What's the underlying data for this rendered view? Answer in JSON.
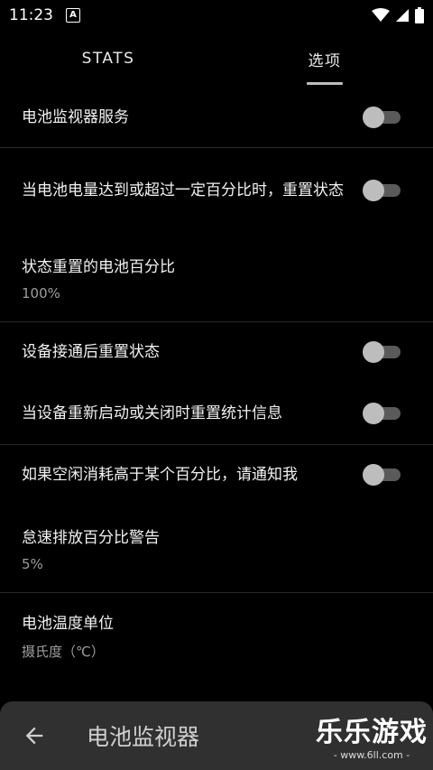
{
  "status": {
    "time": "11:23",
    "badge": "A"
  },
  "tabs": [
    {
      "label": "STATS",
      "active": false
    },
    {
      "label": "选项",
      "active": true
    }
  ],
  "settings": [
    {
      "title": "电池监视器服务",
      "toggle": false
    },
    {
      "title": "当电池电量达到或超过一定百分比时，重置状态",
      "toggle": false
    },
    {
      "title": "状态重置的电池百分比",
      "summary": "100%"
    },
    {
      "title": "设备接通后重置状态",
      "toggle": false
    },
    {
      "title": "当设备重新启动或关闭时重置统计信息",
      "toggle": false
    },
    {
      "title": "如果空闲消耗高于某个百分比，请通知我",
      "toggle": false
    },
    {
      "title": "怠速排放百分比警告",
      "summary": "5%"
    },
    {
      "title": "电池温度单位",
      "summary": "摄氏度（℃）"
    }
  ],
  "bottom_bar": {
    "title": "电池监视器"
  },
  "watermark": {
    "main": "乐乐游戏",
    "sub": "- www.6ll.com -"
  }
}
